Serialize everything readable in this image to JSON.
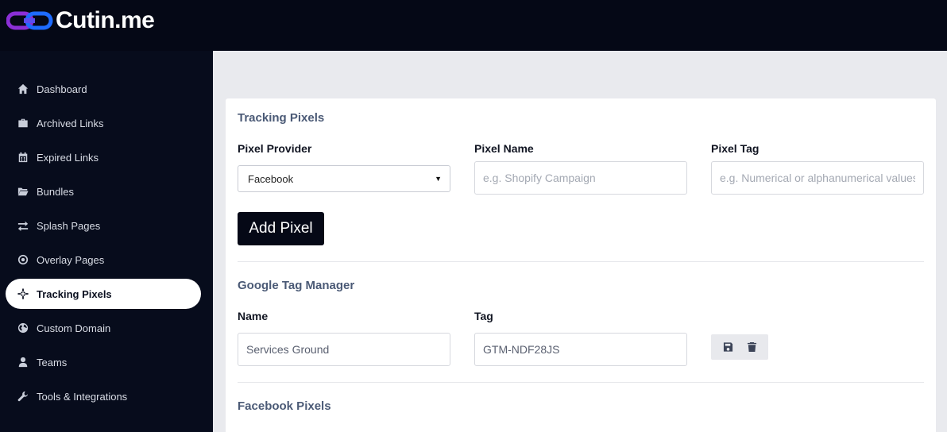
{
  "brand": {
    "name": "Cutin.me"
  },
  "sidebar": {
    "items": [
      {
        "label": "Dashboard",
        "icon": "home-icon"
      },
      {
        "label": "Archived Links",
        "icon": "briefcase-icon"
      },
      {
        "label": "Expired Links",
        "icon": "calendar-icon"
      },
      {
        "label": "Bundles",
        "icon": "folder-icon"
      },
      {
        "label": "Splash Pages",
        "icon": "exchange-icon"
      },
      {
        "label": "Overlay Pages",
        "icon": "dot-circle-icon"
      },
      {
        "label": "Tracking Pixels",
        "icon": "crosshair-icon",
        "active": true
      },
      {
        "label": "Custom Domain",
        "icon": "globe-icon"
      },
      {
        "label": "Teams",
        "icon": "user-icon"
      },
      {
        "label": "Tools & Integrations",
        "icon": "wrench-icon"
      }
    ]
  },
  "tracking": {
    "title": "Tracking Pixels",
    "provider_label": "Pixel Provider",
    "provider_value": "Facebook",
    "name_label": "Pixel Name",
    "name_placeholder": "e.g. Shopify Campaign",
    "tag_label": "Pixel Tag",
    "tag_placeholder": "e.g. Numerical or alphanumerical values",
    "add_button": "Add Pixel"
  },
  "gtm": {
    "title": "Google Tag Manager",
    "name_label": "Name",
    "name_value": "Services Ground",
    "tag_label": "Tag",
    "tag_value": "GTM-NDF28JS"
  },
  "facebook": {
    "title": "Facebook Pixels"
  },
  "colors": {
    "topbar": "#050816",
    "sidebar": "#070c1c",
    "content_bg": "#e9eaee",
    "logo_purple": "#8b2fd6",
    "logo_blue": "#1e6bff"
  }
}
